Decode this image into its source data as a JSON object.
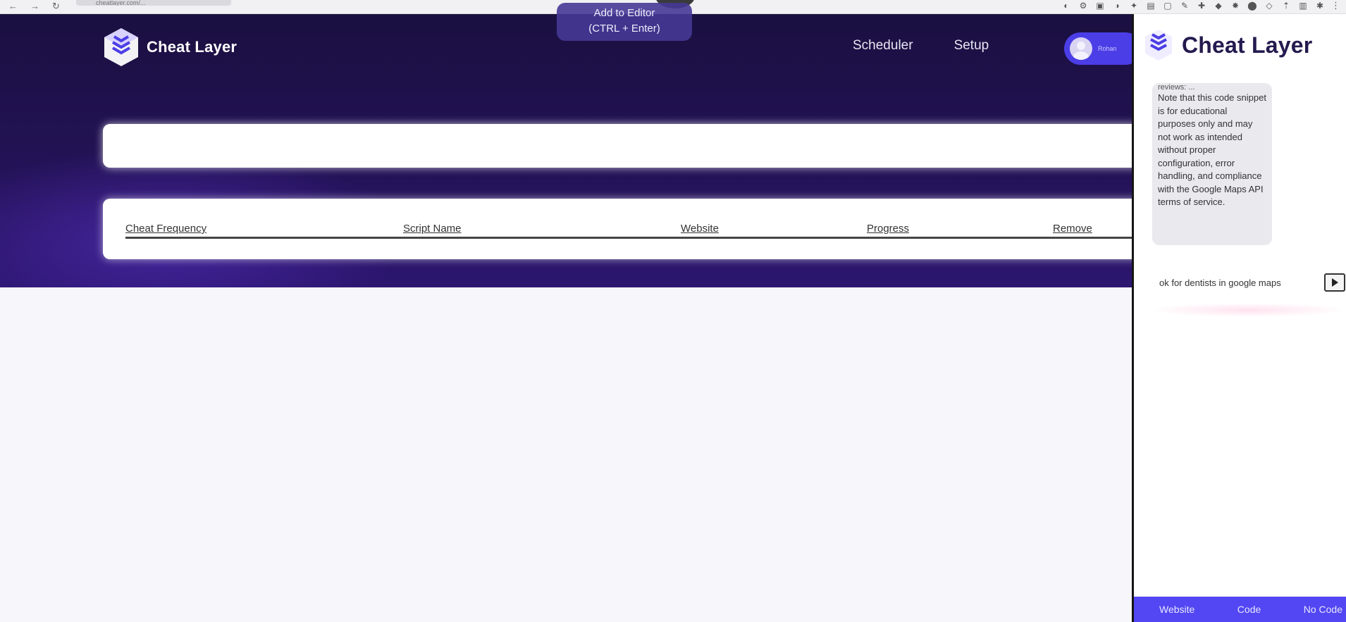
{
  "browser": {
    "nav": [
      "←",
      "→",
      "↻"
    ],
    "url": "cheatlayer.com/...",
    "extensions": [
      "◐",
      "⚙",
      "▣",
      "◑",
      "✦",
      "▤",
      "▢",
      "✎",
      "✚",
      "◆",
      "✸",
      "⬤",
      "◇",
      "⇡",
      "▥",
      "✱"
    ],
    "menu": "⋮"
  },
  "app": {
    "brand": "Cheat Layer",
    "nav": {
      "scheduler": "Scheduler",
      "setup": "Setup"
    },
    "profile": {
      "name": "Rohan"
    },
    "tooltip": {
      "line1": "Add to Editor",
      "line2": "(CTRL + Enter)"
    },
    "table": {
      "columns": [
        "Cheat Frequency",
        "Script Name",
        "Website",
        "Progress",
        "Remove"
      ]
    }
  },
  "panel": {
    "title": "Cheat Layer",
    "message": {
      "clipped": "reviews: ...",
      "text": "Note that this code snippet is for educational purposes only and may not work as intended without proper configuration, error handling, and compliance with the Google Maps API terms of service."
    },
    "input": {
      "value": "ok for dentists in google maps"
    },
    "footer": [
      "Website",
      "Code",
      "No Code"
    ]
  },
  "colors": {
    "hero_dark": "#1a1040",
    "accent": "#5247f2",
    "panel_title": "#251a4f"
  }
}
